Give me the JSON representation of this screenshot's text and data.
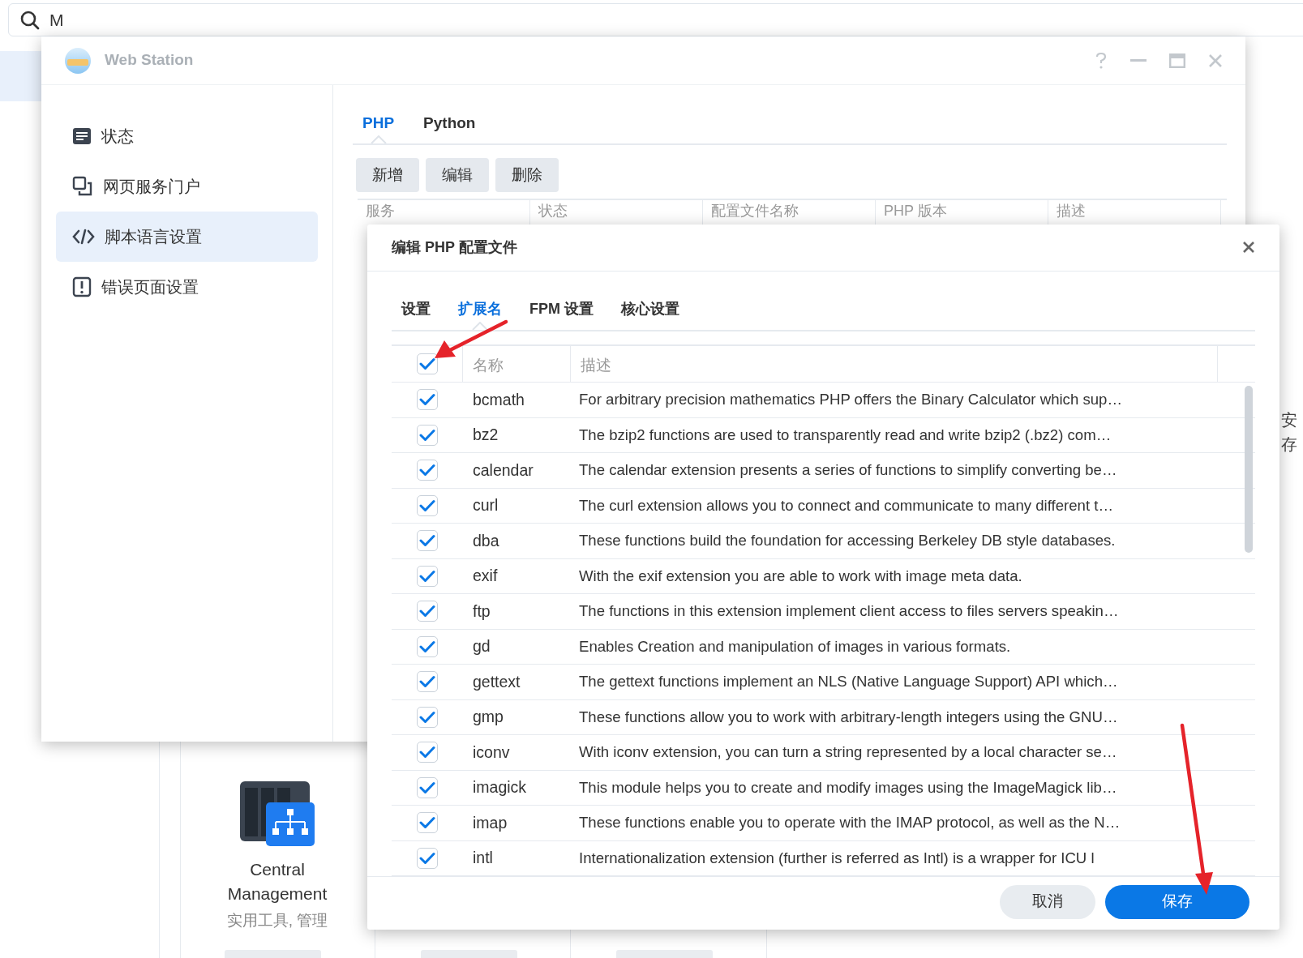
{
  "search": {
    "value": "M"
  },
  "window": {
    "title": "Web Station",
    "sidebar": [
      {
        "label": "状态",
        "selected": false
      },
      {
        "label": "网页服务门户",
        "selected": false
      },
      {
        "label": "脚本语言设置",
        "selected": true
      },
      {
        "label": "错误页面设置",
        "selected": false
      }
    ],
    "tabs": [
      {
        "label": "PHP",
        "selected": true
      },
      {
        "label": "Python",
        "selected": false
      }
    ],
    "toolbar": [
      "新增",
      "编辑",
      "删除"
    ],
    "table": {
      "columns": [
        "服务",
        "状态",
        "配置文件名称",
        "PHP 版本",
        "描述"
      ]
    }
  },
  "dialog": {
    "title": "编辑 PHP 配置文件",
    "tabs": [
      {
        "label": "设置",
        "selected": false
      },
      {
        "label": "扩展名",
        "selected": true
      },
      {
        "label": "FPM 设置",
        "selected": false
      },
      {
        "label": "核心设置",
        "selected": false
      }
    ],
    "table": {
      "columns": [
        "名称",
        "描述"
      ],
      "select_all_checked": true,
      "rows": [
        {
          "name": "bcmath",
          "description": "For arbitrary precision mathematics PHP offers the Binary Calculator which sup…",
          "checked": true
        },
        {
          "name": "bz2",
          "description": "The bzip2 functions are used to transparently read and write bzip2 (.bz2) com…",
          "checked": true
        },
        {
          "name": "calendar",
          "description": "The calendar extension presents a series of functions to simplify converting be…",
          "checked": true
        },
        {
          "name": "curl",
          "description": "The curl extension allows you to connect and communicate to many different t…",
          "checked": true
        },
        {
          "name": "dba",
          "description": "These functions build the foundation for accessing Berkeley DB style databases.",
          "checked": true
        },
        {
          "name": "exif",
          "description": "With the exif extension you are able to work with image meta data.",
          "checked": true
        },
        {
          "name": "ftp",
          "description": "The functions in this extension implement client access to files servers speakin…",
          "checked": true
        },
        {
          "name": "gd",
          "description": "Enables Creation and manipulation of images in various formats.",
          "checked": true
        },
        {
          "name": "gettext",
          "description": "The gettext functions implement an NLS (Native Language Support) API which…",
          "checked": true
        },
        {
          "name": "gmp",
          "description": "These functions allow you to work with arbitrary-length integers using the GNU…",
          "checked": true
        },
        {
          "name": "iconv",
          "description": "With iconv extension, you can turn a string represented by a local character se…",
          "checked": true
        },
        {
          "name": "imagick",
          "description": "This module helps you to create and modify images using the ImageMagick lib…",
          "checked": true
        },
        {
          "name": "imap",
          "description": "These functions enable you to operate with the IMAP protocol, as well as the N…",
          "checked": true
        },
        {
          "name": "intl",
          "description": "Internationalization extension (further is referred as Intl) is a wrapper for ICU l",
          "checked": true
        }
      ]
    },
    "buttons": [
      {
        "label": "取消",
        "kind": "secondary"
      },
      {
        "label": "保存",
        "kind": "primary"
      }
    ]
  },
  "app_tile": {
    "name": "Central Management",
    "category": "实用工具, 管理"
  },
  "edge_text": [
    "安",
    "存"
  ]
}
